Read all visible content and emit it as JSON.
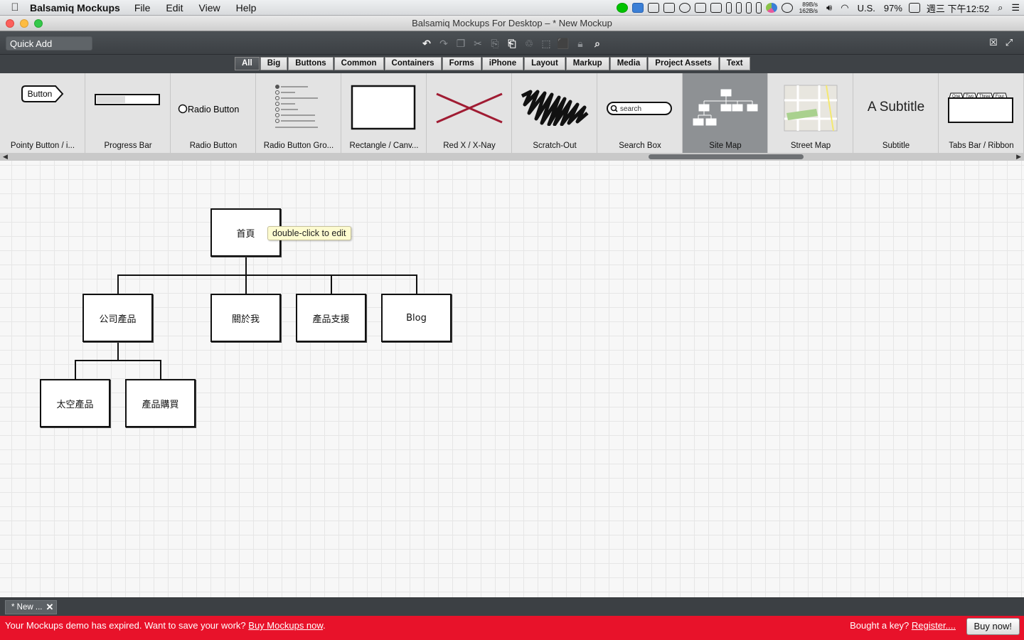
{
  "menubar": {
    "app_name": "Balsamiq Mockups",
    "menus": [
      "File",
      "Edit",
      "View",
      "Help"
    ],
    "net_up": "89B/s",
    "net_down": "162B/s",
    "input_source": "U.S.",
    "battery": "97%",
    "clock": "週三 下午12:52"
  },
  "window": {
    "title": "Balsamiq Mockups For Desktop – * New Mockup"
  },
  "toolbar": {
    "quick_add_value": "Quick Add"
  },
  "categories": {
    "selected": "All",
    "tabs": [
      "All",
      "Big",
      "Buttons",
      "Common",
      "Containers",
      "Forms",
      "iPhone",
      "Layout",
      "Markup",
      "Media",
      "Project Assets",
      "Text"
    ]
  },
  "gallery": {
    "selected": "Site Map",
    "items": [
      "Pointy Button / i...",
      "Progress Bar",
      "Radio Button",
      "Radio Button Gro...",
      "Rectangle / Canv...",
      "Red X / X-Nay",
      "Scratch-Out",
      "Search Box",
      "Site Map",
      "Street Map",
      "Subtitle",
      "Tabs Bar / Ribbon"
    ],
    "thumbs": {
      "pointy_button": "Button",
      "radio_button": "Radio Button",
      "search_box": "search",
      "subtitle": "A Subtitle",
      "tabs": [
        "One",
        "Two",
        "Three",
        "Four"
      ]
    }
  },
  "canvas": {
    "tooltip": "double-click to edit",
    "sitemap": {
      "root": "首頁",
      "level1": [
        "公司產品",
        "關於我",
        "產品支援",
        "Blog"
      ],
      "level2": [
        "太空產品",
        "產品購買"
      ]
    }
  },
  "document_tab": "* New ...",
  "footer": {
    "message": "Your Mockups demo has expired. Want to save your work?",
    "buy_link": "Buy Mockups now",
    "key_prompt": "Bought a key?",
    "register_link": "Register....",
    "buy_button": "Buy now!"
  },
  "colors": {
    "footer_bg": "#e8122a",
    "red_x": "#a01c33",
    "selected_gallery": "#8e9194"
  }
}
